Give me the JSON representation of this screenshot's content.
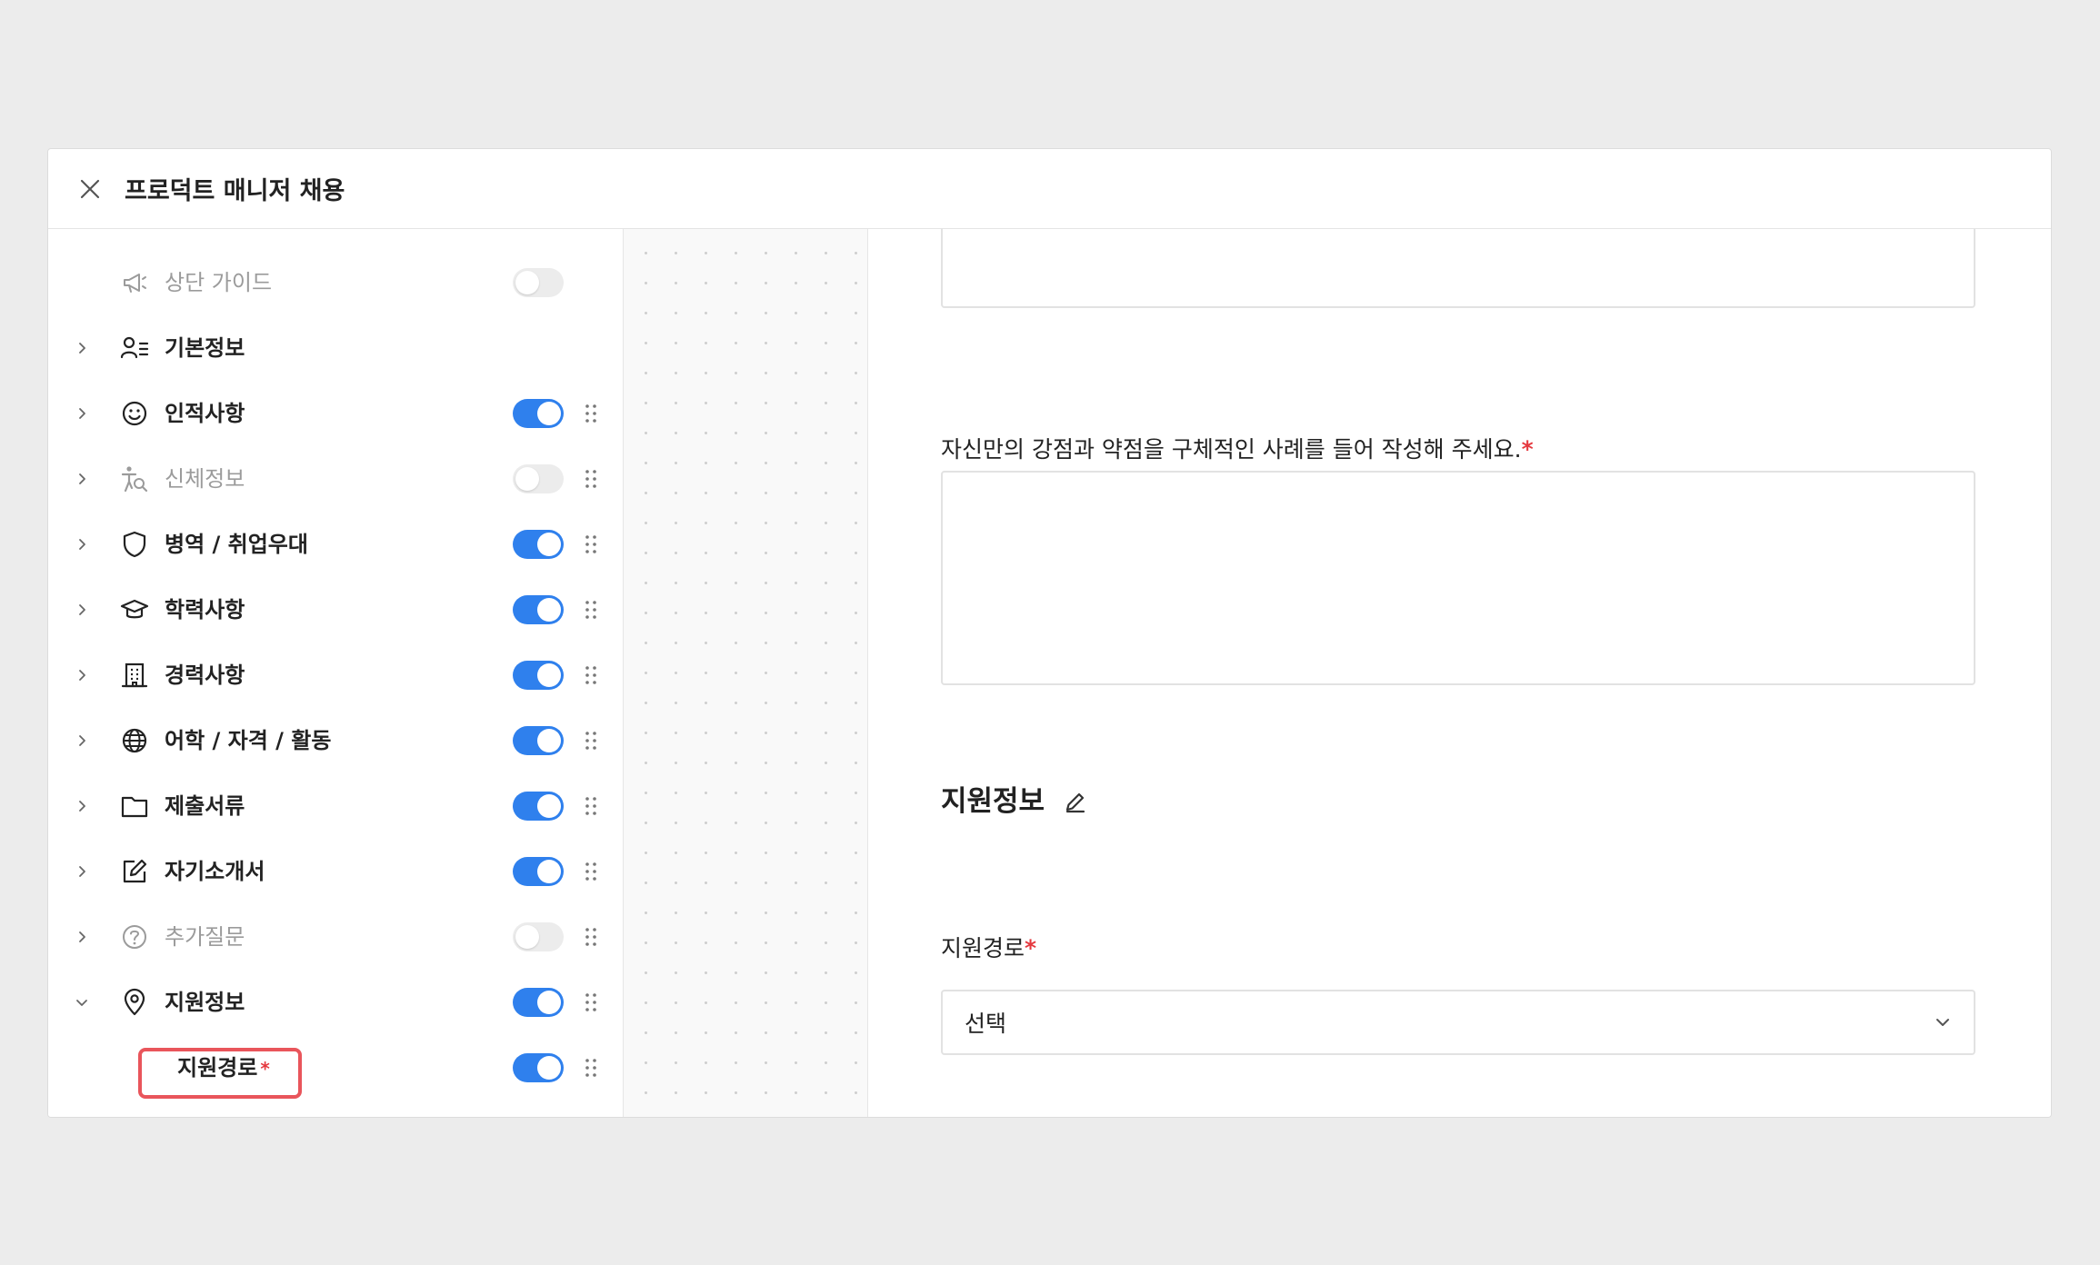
{
  "window": {
    "title": "프로덕트 매니저 채용"
  },
  "sidebar": {
    "items": [
      {
        "label": "상단 가이드",
        "icon": "megaphone-icon",
        "enabled": false,
        "muted": true,
        "has_chevron": false,
        "has_grip": false
      },
      {
        "label": "기본정보",
        "icon": "user-list-icon",
        "enabled": null,
        "muted": false,
        "has_chevron": true,
        "has_grip": false
      },
      {
        "label": "인적사항",
        "icon": "smiley-icon",
        "enabled": true,
        "muted": false,
        "has_chevron": true,
        "has_grip": true
      },
      {
        "label": "신체정보",
        "icon": "body-search-icon",
        "enabled": false,
        "muted": true,
        "has_chevron": true,
        "has_grip": true
      },
      {
        "label": "병역 / 취업우대",
        "icon": "shield-icon",
        "enabled": true,
        "muted": false,
        "has_chevron": true,
        "has_grip": true
      },
      {
        "label": "학력사항",
        "icon": "graduation-cap-icon",
        "enabled": true,
        "muted": false,
        "has_chevron": true,
        "has_grip": true
      },
      {
        "label": "경력사항",
        "icon": "building-icon",
        "enabled": true,
        "muted": false,
        "has_chevron": true,
        "has_grip": true
      },
      {
        "label": "어학 / 자격 / 활동",
        "icon": "globe-icon",
        "enabled": true,
        "muted": false,
        "has_chevron": true,
        "has_grip": true
      },
      {
        "label": "제출서류",
        "icon": "folder-icon",
        "enabled": true,
        "muted": false,
        "has_chevron": true,
        "has_grip": true
      },
      {
        "label": "자기소개서",
        "icon": "edit-square-icon",
        "enabled": true,
        "muted": false,
        "has_chevron": true,
        "has_grip": true
      },
      {
        "label": "추가질문",
        "icon": "question-circle-icon",
        "enabled": false,
        "muted": true,
        "has_chevron": true,
        "has_grip": true
      },
      {
        "label": "지원정보",
        "icon": "location-pin-icon",
        "enabled": true,
        "muted": false,
        "has_chevron": true,
        "expanded": true,
        "has_grip": true
      }
    ],
    "subitem": {
      "label": "지원경로",
      "required_mark": "*",
      "enabled": true
    }
  },
  "main": {
    "question_label": "자신만의 강점과 약점을 구체적인 사례를 들어 작성해 주세요.",
    "required_mark": "*",
    "section_title": "지원정보",
    "field_label": "지원경로",
    "select_value": "선택"
  },
  "colors": {
    "accent": "#2f80ed",
    "required": "#e5393f",
    "highlight_border": "#e9555b",
    "background": "#ececec"
  }
}
